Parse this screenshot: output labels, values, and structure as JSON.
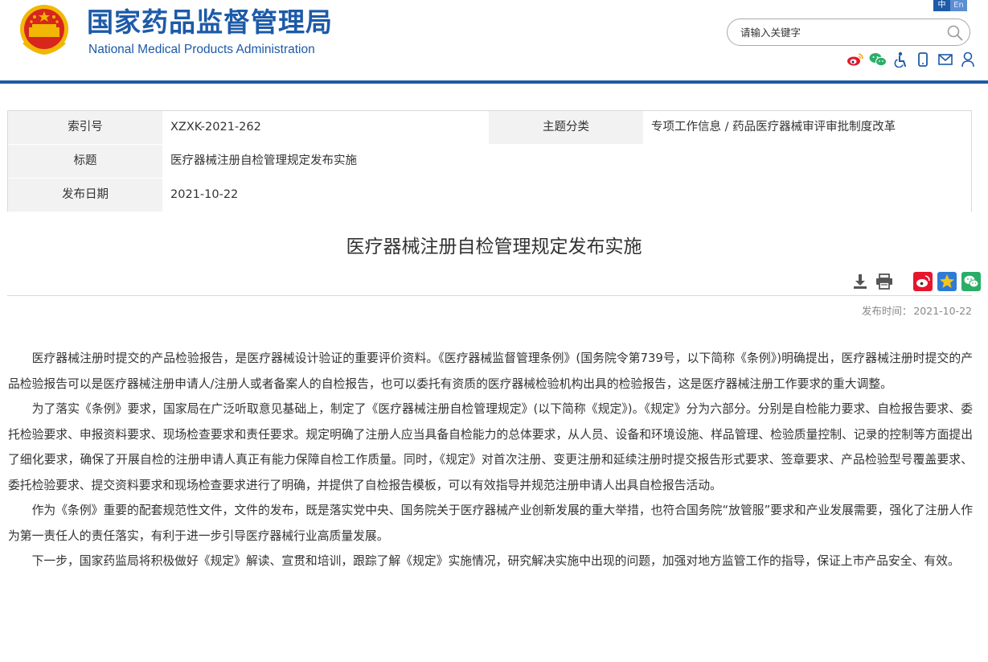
{
  "header": {
    "title_cn": "国家药品监督管理局",
    "title_en": "National Medical Products Administration",
    "lang": {
      "cn": "中",
      "en": "En"
    },
    "search_placeholder": "请输入关键字"
  },
  "toolbar_icons": [
    "weibo-icon",
    "wechat-icon",
    "accessibility-icon",
    "mobile-icon",
    "mail-icon",
    "user-icon"
  ],
  "info": {
    "index_label": "索引号",
    "index_value": "XZXK-2021-262",
    "category_label": "主题分类",
    "category_value": "专项工作信息 / 药品医疗器械审评审批制度改革",
    "title_label": "标题",
    "title_value": "医疗器械注册自检管理规定发布实施",
    "date_label": "发布日期",
    "date_value": "2021-10-22"
  },
  "article": {
    "title": "医疗器械注册自检管理规定发布实施",
    "publish_label": "发布时间：",
    "publish_value": "2021-10-22",
    "paragraphs": [
      "医疗器械注册时提交的产品检验报告，是医疗器械设计验证的重要评价资料。《医疗器械监督管理条例》(国务院令第739号，以下简称《条例》)明确提出，医疗器械注册时提交的产品检验报告可以是医疗器械注册申请人/注册人或者备案人的自检报告，也可以委托有资质的医疗器械检验机构出具的检验报告，这是医疗器械注册工作要求的重大调整。",
      "为了落实《条例》要求，国家局在广泛听取意见基础上，制定了《医疗器械注册自检管理规定》(以下简称《规定》)。《规定》分为六部分。分别是自检能力要求、自检报告要求、委托检验要求、申报资料要求、现场检查要求和责任要求。规定明确了注册人应当具备自检能力的总体要求，从人员、设备和环境设施、样品管理、检验质量控制、记录的控制等方面提出了细化要求，确保了开展自检的注册申请人真正有能力保障自检工作质量。同时，《规定》对首次注册、变更注册和延续注册时提交报告形式要求、签章要求、产品检验型号覆盖要求、委托检验要求、提交资料要求和现场检查要求进行了明确，并提供了自检报告模板，可以有效指导并规范注册申请人出具自检报告活动。",
      "作为《条例》重要的配套规范性文件，文件的发布，既是落实党中央、国务院关于医疗器械产业创新发展的重大举措，也符合国务院“放管服”要求和产业发展需要，强化了注册人作为第一责任人的责任落实，有利于进一步引导医疗器械行业高质量发展。",
      "下一步，国家药监局将积极做好《规定》解读、宣贯和培训，跟踪了解《规定》实施情况，研究解决实施中出现的问题，加强对地方监管工作的指导，保证上市产品安全、有效。"
    ]
  },
  "colors": {
    "brand": "#1d5aa8",
    "weibo": "#e6162d",
    "wechat": "#2aae67",
    "favorite": "#f5a623"
  }
}
